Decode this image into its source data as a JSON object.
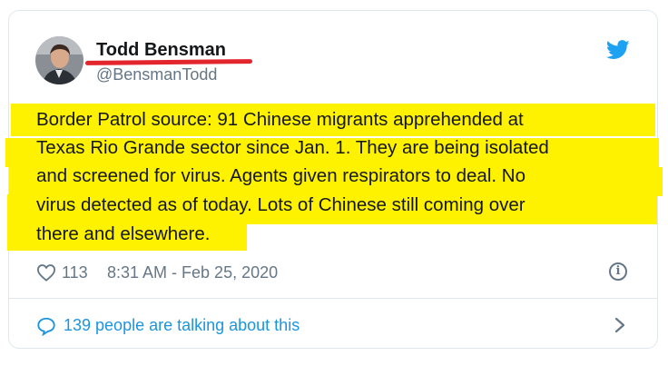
{
  "author": {
    "name": "Todd Bensman",
    "handle": "@BensmanTodd"
  },
  "tweet": {
    "lines": [
      "Border Patrol source: 91 Chinese migrants apprehended at",
      "Texas Rio Grande sector since Jan. 1. They are being isolated",
      "and screened for virus. Agents given respirators to deal. No",
      "virus detected as of today. Lots of Chinese still coming over",
      "there and elsewhere."
    ],
    "highlight_color": "#fff200"
  },
  "meta": {
    "like_count": "113",
    "timestamp": "8:31 AM - Feb 25, 2020",
    "info_icon": "info-icon"
  },
  "footer": {
    "talking_label": "139 people are talking about this"
  },
  "colors": {
    "twitter_blue": "#1da1f2",
    "link_blue": "#1b95e0",
    "underline_red": "#e3262e"
  }
}
